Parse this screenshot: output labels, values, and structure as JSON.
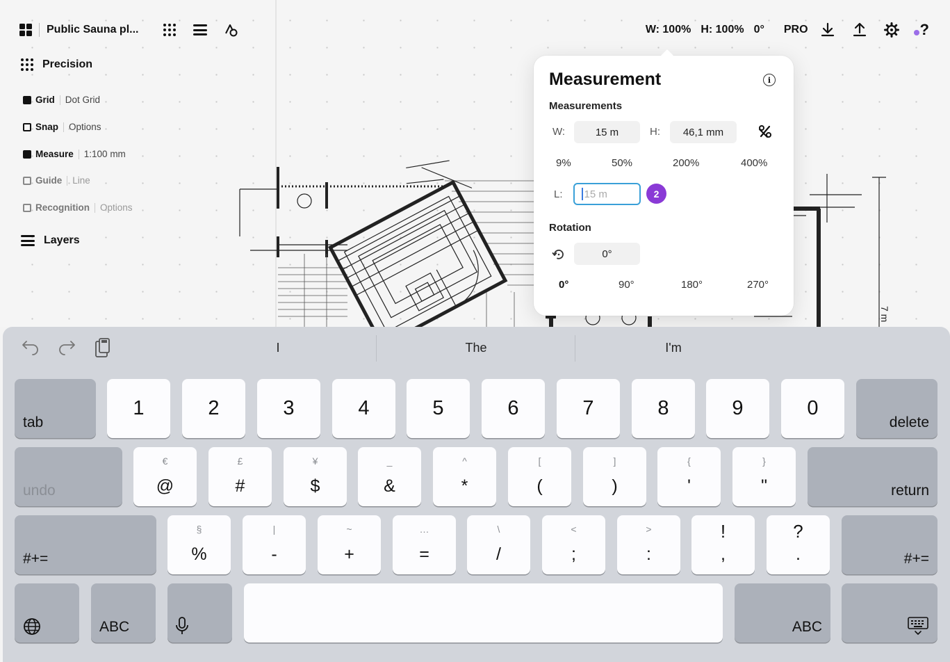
{
  "toolbar": {
    "doc_title": "Public Sauna pl...",
    "width_stat": "W: 100%",
    "height_stat": "H: 100%",
    "rotation_stat": "0°",
    "pro_label": "PRO",
    "help_label": "?"
  },
  "panel": {
    "precision_title": "Precision",
    "layers_title": "Layers",
    "options": [
      {
        "name": "Grid",
        "value": "Dot Grid",
        "checked": true,
        "enabled": true
      },
      {
        "name": "Snap",
        "value": "Options",
        "checked": false,
        "enabled": true
      },
      {
        "name": "Measure",
        "value": "1:100 mm",
        "checked": true,
        "enabled": true
      },
      {
        "name": "Guide",
        "value": "Line",
        "checked": false,
        "enabled": false
      },
      {
        "name": "Recognition",
        "value": "Options",
        "checked": false,
        "enabled": false
      }
    ]
  },
  "drawing": {
    "dimension_label": "7 m"
  },
  "measurement": {
    "title": "Measurement",
    "info_glyph": "i",
    "measurements_section": "Measurements",
    "w_label": "W:",
    "w_value": "15 m",
    "h_label": "H:",
    "h_value": "46,1 mm",
    "scale_presets": [
      "9%",
      "50%",
      "200%",
      "400%"
    ],
    "l_label": "L:",
    "l_placeholder": "15 m",
    "step_badge": "2",
    "rotation_section": "Rotation",
    "rotation_value": "0°",
    "rotation_presets": [
      "0°",
      "90°",
      "180°",
      "270°"
    ]
  },
  "keyboard": {
    "suggestions": [
      "I",
      "The",
      "I'm"
    ],
    "row1": [
      "1",
      "2",
      "3",
      "4",
      "5",
      "6",
      "7",
      "8",
      "9",
      "0"
    ],
    "row2": [
      {
        "sec": "€",
        "pri": "@"
      },
      {
        "sec": "£",
        "pri": "#"
      },
      {
        "sec": "¥",
        "pri": "$"
      },
      {
        "sec": "_",
        "pri": "&"
      },
      {
        "sec": "^",
        "pri": "*"
      },
      {
        "sec": "[",
        "pri": "("
      },
      {
        "sec": "]",
        "pri": ")"
      },
      {
        "sec": "{",
        "pri": "'"
      },
      {
        "sec": "}",
        "pri": "\""
      }
    ],
    "row3": [
      {
        "sec": "§",
        "pri": "%"
      },
      {
        "sec": "|",
        "pri": "-"
      },
      {
        "sec": "~",
        "pri": "+"
      },
      {
        "sec": "…",
        "pri": "="
      },
      {
        "sec": "\\",
        "pri": "/"
      },
      {
        "sec": "<",
        "pri": ";"
      },
      {
        "sec": ">",
        "pri": ":"
      },
      {
        "sec": "!",
        "pri": ","
      },
      {
        "sec": "?",
        "pri": "."
      }
    ],
    "tab": "tab",
    "delete": "delete",
    "undo": "undo",
    "return": "return",
    "more_left": "#+=",
    "more_right": "#+=",
    "abc_left": "ABC",
    "abc_right": "ABC"
  },
  "colors": {
    "accent_purple": "#8a3ad6",
    "focus_blue": "#3aa0d8",
    "keyboard_bg": "#d2d5db"
  }
}
